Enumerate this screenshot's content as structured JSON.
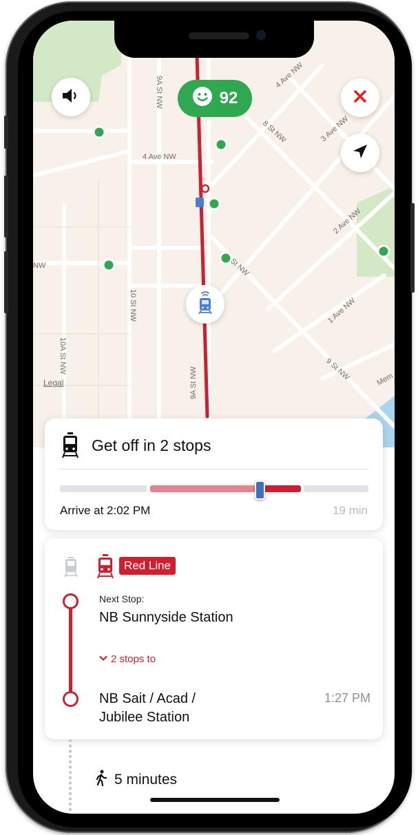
{
  "map": {
    "score": "92",
    "legal": "Legal",
    "streets": {
      "ave4_top": "4 Ave NW",
      "ave4_left": "4 Ave NW",
      "st8": "8 St NW",
      "ave3": "3 Ave NW",
      "ave2": "2 Ave NW",
      "ave1": "1 Ave NW",
      "st9a_top": "9A St NW",
      "st9a_bottom": "9A St NW",
      "st10": "10 St NW",
      "st10a": "10A St NW",
      "nw_left": "NW",
      "st_nw": "St NW",
      "st9": "9 St NW",
      "mem": "Mem"
    },
    "icons": {
      "volume": "speaker-icon",
      "close": "close-icon",
      "locate": "navigation-arrow-icon",
      "score": "smiley-icon",
      "vehicle": "train-icon"
    }
  },
  "trip_summary": {
    "title": "Get off in 2 stops",
    "arrive": "Arrive at 2:02 PM",
    "duration": "19 min",
    "progress": 0.6
  },
  "route_card": {
    "line_name": "Red Line",
    "next_stop_label": "Next Stop:",
    "next_stop": "NB Sunnyside Station",
    "stops_toggle": "2 stops to",
    "destination_line1": "NB Sait / Acad /",
    "destination_line2": "Jubilee Station",
    "destination_time": "1:27 PM"
  },
  "walk": {
    "label": "5 minutes"
  },
  "colors": {
    "red_line": "#cf1f2e",
    "score_green": "#2fa84f",
    "map_bg": "#f7f1e9",
    "park_green": "#d3e9c6",
    "water": "#a9d5ee"
  }
}
